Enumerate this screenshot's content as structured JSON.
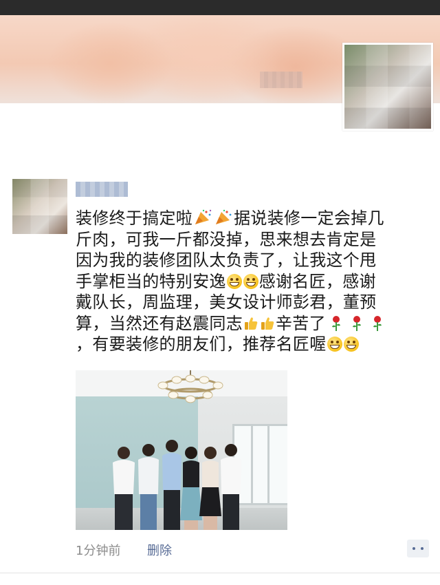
{
  "post": {
    "text_lines": [
      [
        "装修终于搞定啦",
        "据说装修一定会掉几"
      ],
      [
        "斤肉，可我一斤都没掉，思来想去肯定是"
      ],
      [
        "因为我的装修团队太负责了，让我这个甩"
      ],
      [
        "手掌柜当的特别安逸",
        "感谢名匠，感谢"
      ],
      [
        "戴队长，周监理，美女设计师彭君，董预"
      ],
      [
        "算，当然还有赵震同志",
        "辛苦了"
      ],
      [
        "，有要装修的朋友们，推荐名匠喔"
      ]
    ],
    "emojis": {
      "party": "party-popper-icon",
      "grin": "grinning-face-icon",
      "thumb": "thumbs-up-icon",
      "rose": "rose-icon"
    }
  },
  "footer": {
    "time": "1分钟前",
    "delete": "删除"
  },
  "colors": {
    "link": "#576b95",
    "meta": "#8c8c8c"
  }
}
